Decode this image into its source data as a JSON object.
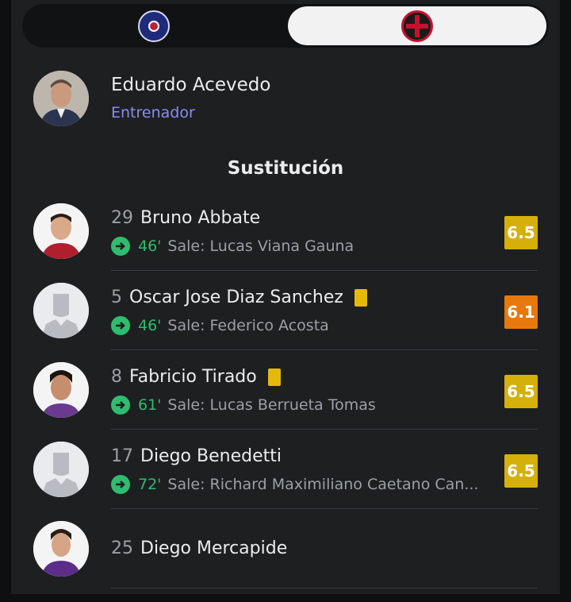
{
  "tabs": [
    {
      "label": "Team A crest",
      "active": false
    },
    {
      "label": "Team B crest",
      "active": true
    }
  ],
  "coach": {
    "name": "Eduardo Acevedo",
    "role": "Entrenador"
  },
  "section_title": "Sustitución",
  "subs_prefix": "Sale:",
  "players": [
    {
      "number": "29",
      "name": "Bruno Abbate",
      "minute": "46'",
      "out": "Lucas Viana Gauna",
      "rating": "6.5",
      "rating_color": "#d4b10a",
      "yellow_card": false
    },
    {
      "number": "5",
      "name": "Oscar Jose Diaz Sanchez",
      "minute": "46'",
      "out": "Federico Acosta",
      "rating": "6.1",
      "rating_color": "#e8780c",
      "yellow_card": true
    },
    {
      "number": "8",
      "name": "Fabricio Tirado",
      "minute": "61'",
      "out": "Lucas Berrueta Tomas",
      "rating": "6.5",
      "rating_color": "#d4b10a",
      "yellow_card": true
    },
    {
      "number": "17",
      "name": "Diego Benedetti",
      "minute": "72'",
      "out": "Richard Maximiliano Caetano Can...",
      "rating": "6.5",
      "rating_color": "#d4b10a",
      "yellow_card": false
    },
    {
      "number": "25",
      "name": "Diego Mercapide"
    }
  ]
}
